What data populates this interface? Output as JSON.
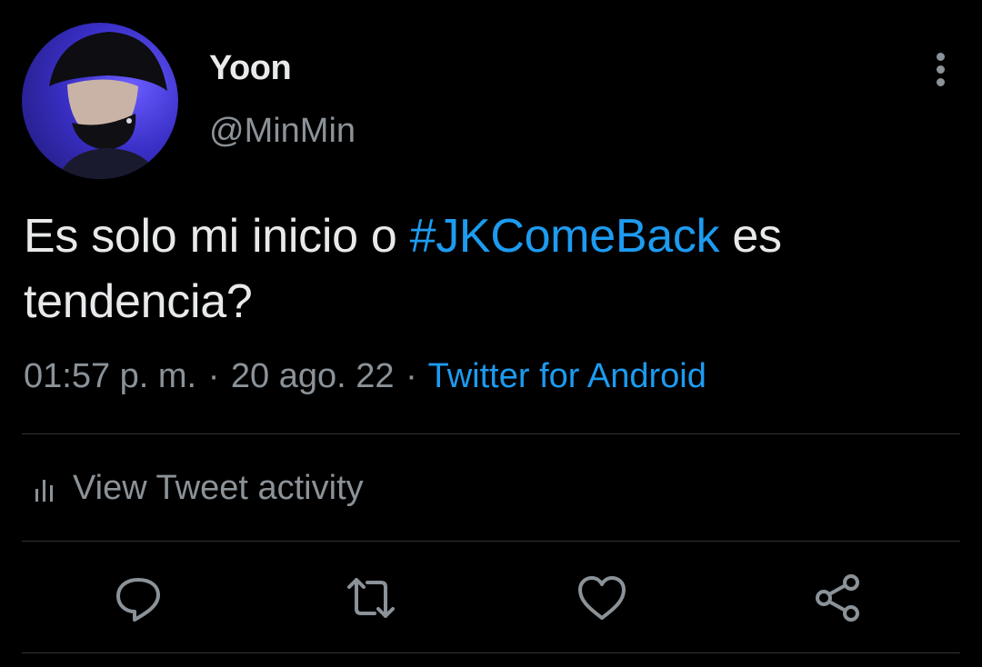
{
  "user": {
    "display_name": "Yoon",
    "handle": "@MinMin"
  },
  "tweet": {
    "text_before": "Es solo mi inicio o ",
    "hashtag": "#JKComeBack",
    "text_after": " es tendencia?"
  },
  "meta": {
    "time": "01:57 p. m.",
    "separator": "·",
    "date": "20 ago. 22",
    "source": "Twitter for Android"
  },
  "activity": {
    "label": "View Tweet activity",
    "icon": "bar-chart-icon"
  },
  "actions": [
    {
      "name": "reply",
      "icon": "reply-icon"
    },
    {
      "name": "retweet",
      "icon": "retweet-icon"
    },
    {
      "name": "like",
      "icon": "heart-icon"
    },
    {
      "name": "share",
      "icon": "share-icon"
    }
  ],
  "colors": {
    "background": "#000000",
    "text": "#e7e9ea",
    "secondary_text": "#8b9298",
    "link": "#1d9bf0",
    "divider": "#2f3336"
  }
}
